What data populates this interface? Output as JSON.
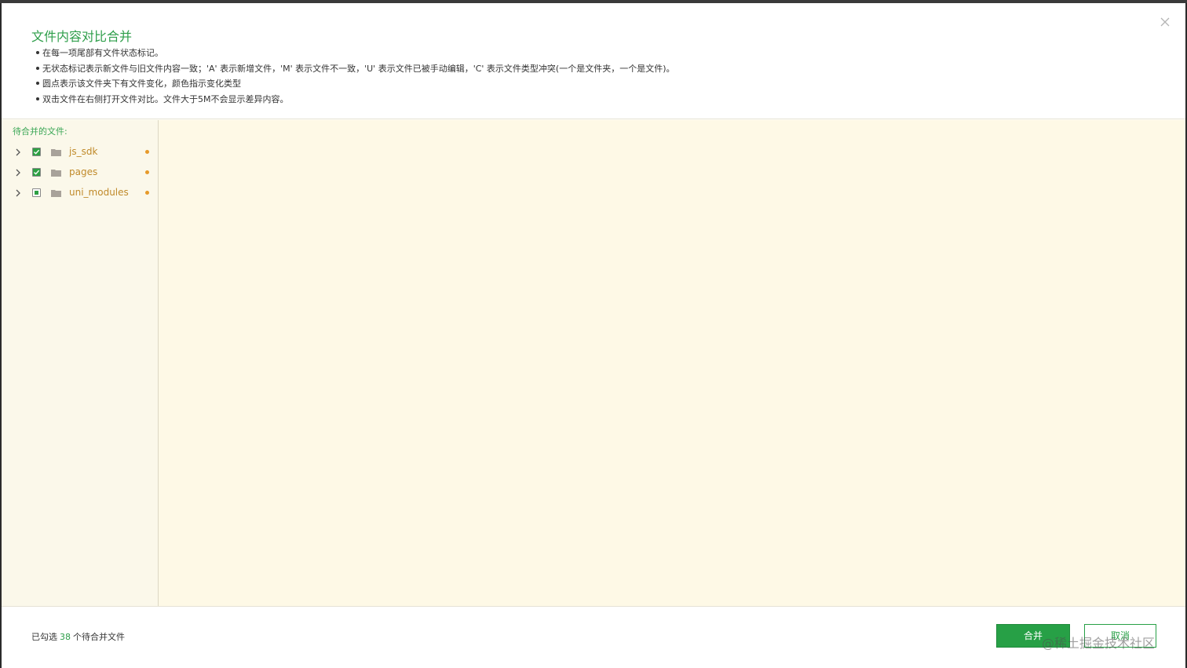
{
  "dialog": {
    "title": "文件内容对比合并",
    "notes": [
      "在每一项尾部有文件状态标记。",
      "无状态标记表示新文件与旧文件内容一致；'A' 表示新增文件，'M' 表示文件不一致，'U' 表示文件已被手动编辑，'C' 表示文件类型冲突(一个是文件夹，一个是文件)。",
      "圆点表示该文件夹下有文件变化，颜色指示变化类型",
      "双击文件在右侧打开文件对比。文件大于5M不会显示差异内容。"
    ]
  },
  "left_panel": {
    "label": "待合并的文件:",
    "items": [
      {
        "label": "js_sdk",
        "checked": "checked"
      },
      {
        "label": "pages",
        "checked": "checked"
      },
      {
        "label": "uni_modules",
        "checked": "partial"
      }
    ]
  },
  "footer": {
    "status_prefix": "已勾选",
    "count": "38",
    "status_suffix": "个待合并文件",
    "merge_label": "合并",
    "cancel_label": "取消",
    "watermark": "@稀土掘金技术社区"
  },
  "colors": {
    "accent": "#27a046",
    "folder_label": "#c08a2a",
    "change_dot": "#e69a2a",
    "panel_bg": "#fef9e6"
  },
  "icons": {
    "close": "close-icon",
    "chevron": "chevron-right-icon",
    "folder": "folder-icon",
    "check": "checkbox-checked-icon"
  }
}
